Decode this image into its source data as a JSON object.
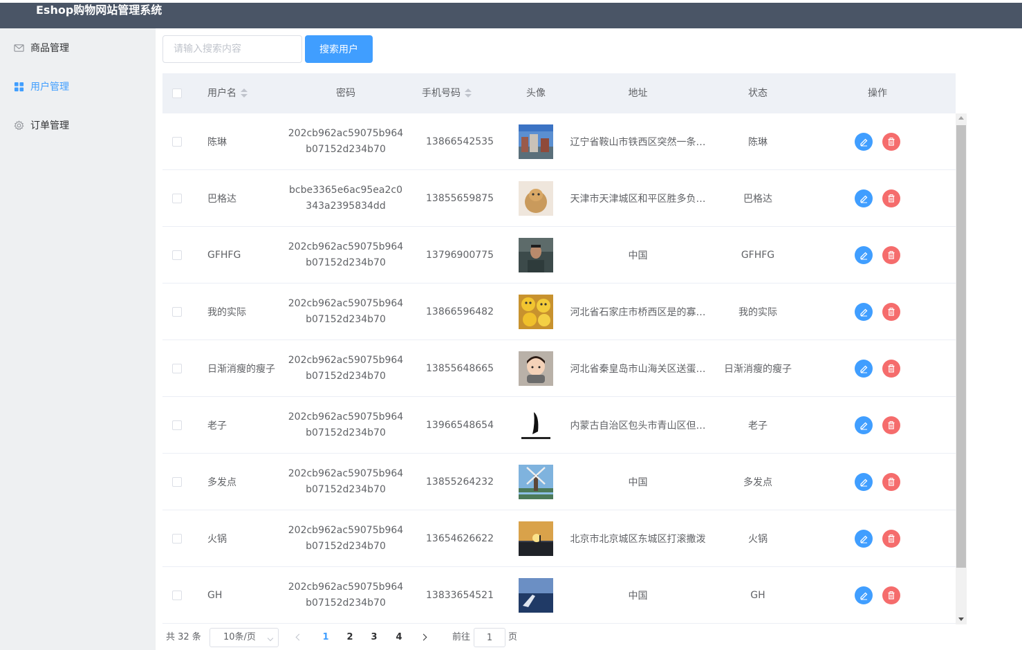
{
  "app": {
    "title": "Eshop购物网站管理系统"
  },
  "sidebar": {
    "items": [
      {
        "label": "商品管理",
        "icon": "mail-icon",
        "active": false
      },
      {
        "label": "用户管理",
        "icon": "grid-icon",
        "active": true
      },
      {
        "label": "订单管理",
        "icon": "gear-icon",
        "active": false
      }
    ]
  },
  "search": {
    "placeholder": "请输入搜索内容",
    "value": "",
    "button_label": "搜索用户"
  },
  "table": {
    "columns": [
      "用户名",
      "密码",
      "手机号码",
      "头像",
      "地址",
      "状态",
      "操作"
    ],
    "rows": [
      {
        "username": "陈琳",
        "password": "202cb962ac59075b964b07152d234b70",
        "phone": "13866542535",
        "avatar": "city-buildings-photo",
        "address": "辽宁省鞍山市铁西区突然一条…",
        "status": "陈琳"
      },
      {
        "username": "巴格达",
        "password": "bcbe3365e6ac95ea2c0343a2395834dd",
        "phone": "13855659875",
        "avatar": "cat-in-bag-photo",
        "address": "天津市天津城区和平区胜多负…",
        "status": "巴格达"
      },
      {
        "username": "GFHFG",
        "password": "202cb962ac59075b964b07152d234b70",
        "phone": "13796900775",
        "avatar": "man-portrait-photo",
        "address": "中国",
        "status": "GFHFG"
      },
      {
        "username": "我的实际",
        "password": "202cb962ac59075b964b07152d234b70",
        "phone": "13866596482",
        "avatar": "emoji-faces-photo",
        "address": "河北省石家庄市桥西区是的寡…",
        "status": "我的实际"
      },
      {
        "username": "日渐消瘦的瘦子",
        "password": "202cb962ac59075b964b07152d234b70",
        "phone": "13855648665",
        "avatar": "cartoon-boy-photo",
        "address": "河北省秦皇岛市山海关区送蛋…",
        "status": "日渐消瘦的瘦子"
      },
      {
        "username": "老子",
        "password": "202cb962ac59075b964b07152d234b70",
        "phone": "13966548654",
        "avatar": "silhouette-logo-image",
        "address": "内蒙古自治区包头市青山区但…",
        "status": "老子"
      },
      {
        "username": "多发点",
        "password": "202cb962ac59075b964b07152d234b70",
        "phone": "13855264232",
        "avatar": "windmill-photo",
        "address": "中国",
        "status": "多发点"
      },
      {
        "username": "火锅",
        "password": "202cb962ac59075b964b07152d234b70",
        "phone": "13654626622",
        "avatar": "sunset-sky-photo",
        "address": "北京市北京城区东城区打滚撒泼",
        "status": "火锅"
      },
      {
        "username": "GH",
        "password": "202cb962ac59075b964b07152d234b70",
        "phone": "13833654521",
        "avatar": "ocean-boat-photo",
        "address": "中国",
        "status": "GH"
      }
    ]
  },
  "pagination": {
    "total_text": "共 32 条",
    "page_size": "10条/页",
    "pages": [
      "1",
      "2",
      "3",
      "4"
    ],
    "current_page": "1",
    "goto_label": "前往",
    "goto_value": "1",
    "page_suffix": "页"
  },
  "colors": {
    "header_bg": "#4a5566",
    "sidebar_bg": "#eef0f2",
    "accent": "#409eff",
    "danger": "#f56c6c",
    "table_head_bg": "#eef1f6"
  }
}
